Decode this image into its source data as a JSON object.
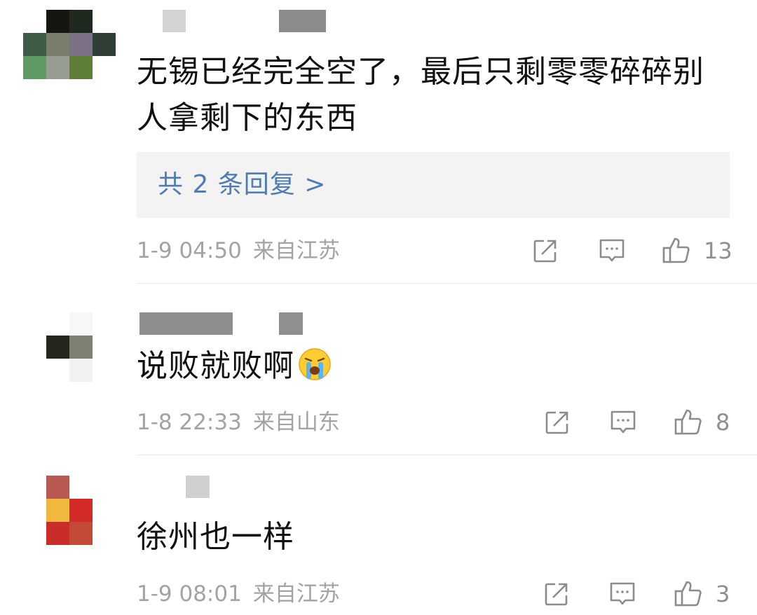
{
  "colors": {
    "text": "#111111",
    "meta": "#a3a3a3",
    "link": "#4f7db3",
    "reply_bg": "#f3f3f3",
    "divider": "#e6e6e6"
  },
  "comments": [
    {
      "text": "无锡已经完全空了，最后只剩零零碎碎别人拿剩下的东西",
      "replies_label": "共 2 条回复 >",
      "time": "1-9 04:50",
      "location": "来自江苏",
      "likes": "13"
    },
    {
      "text": "说败就败啊",
      "emoji": "loudly-crying-face",
      "time": "1-8 22:33",
      "location": "来自山东",
      "likes": "8"
    },
    {
      "text": "徐州也一样",
      "time": "1-9 08:01",
      "location": "来自江苏",
      "likes": "3"
    }
  ],
  "icons": {
    "share": "share-icon",
    "comment": "comment-icon",
    "like": "thumbs-up-icon"
  }
}
